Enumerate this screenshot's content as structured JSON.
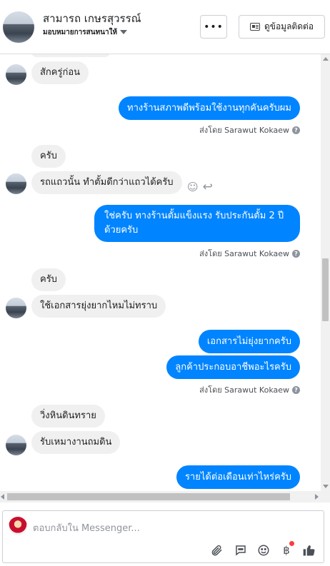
{
  "header": {
    "name": "สามารถ เกษรสุวรรณ์",
    "subtitle": "มอบหมายการสนทนาให้",
    "more_label": "•••",
    "info_label": "ดูข้อมูลติดต่อ"
  },
  "messages": {
    "m0": "สักครู่ก่อน",
    "m1": "ทางร้านสภาพดีพร้อมใช้งานทุกคันครับผม",
    "m1_sent_by": "ส่งโดย Sarawut Kokaew",
    "m2": "ครับ",
    "m3": "รถแถวนั้น ทำตั้มดีกว่าแถวได้ครับ",
    "m4_line1": "ใช่ครับ ทางร้านตั้มแข็งแรง รับประกันตั้ม 2 ปี",
    "m4_line2": "ด้วยครับ",
    "m4_sent_by": "ส่งโดย Sarawut Kokaew",
    "m5": "ครับ",
    "m6": "ใช้เอกสารยุ่งยากไหมไม่ทราบ",
    "m7": "เอกสารไม่ยุ่งยากครับ",
    "m8": "ลูกค้าประกอบอาชีพอะไรครับ",
    "m8_sent_by": "ส่งโดย Sarawut Kokaew",
    "m9": "วิ่งหินดินทราย",
    "m10": "รับเหมางานถมดิน",
    "m11": "รายได้ต่อเดือนเท่าไหร่ครับ"
  },
  "composer": {
    "placeholder": "ตอบกลับใน Messenger..."
  },
  "icons": {
    "attach": "paperclip-icon",
    "gif": "speech-bubble-icon",
    "emoji": "smile-icon",
    "payment": "baht-icon",
    "like": "thumbs-up-icon"
  },
  "colors": {
    "outgoing_bubble": "#0084ff",
    "incoming_bubble": "#f1f0f0"
  }
}
